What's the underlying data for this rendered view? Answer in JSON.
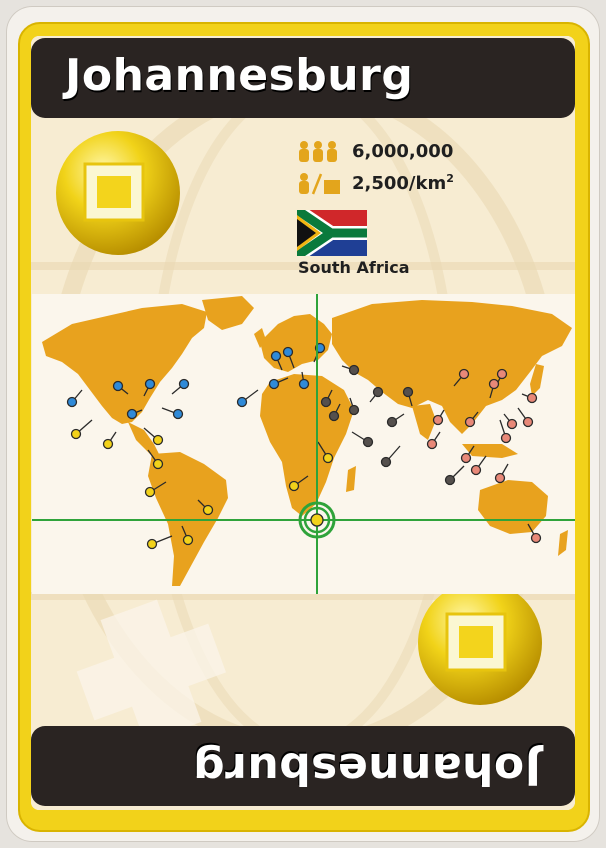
{
  "card": {
    "city": "Johannesburg",
    "country": "South Africa",
    "population": "6,000,000",
    "density_value": "2,500/km",
    "density_exp": "2",
    "population_icon": "people-icon",
    "density_icon": "person-per-area-icon"
  },
  "colors": {
    "frame_yellow": "#f2d21a",
    "banner_black": "#2a2422",
    "land": "#e8a21e",
    "grid_green": "#2fa33a"
  }
}
